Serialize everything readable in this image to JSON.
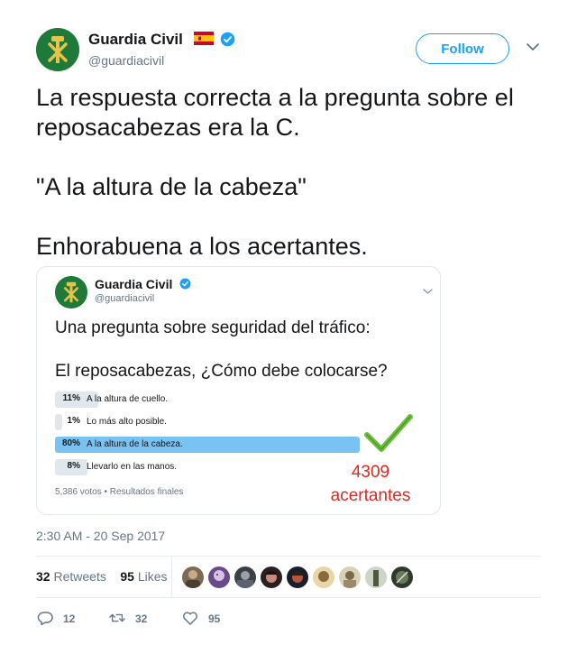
{
  "tweet": {
    "author_name": "Guardia Civil",
    "author_handle": "@guardiacivil",
    "follow_label": "Follow",
    "text": "La respuesta correcta a la pregunta sobre el\nreposacabezas era la C.\n\n\"A la altura de la cabeza\"\n\nEnhorabuena a los acertantes.",
    "timestamp": "2:30 AM - 20 Sep 2017",
    "retweets_count": "32",
    "retweets_label": "Retweets",
    "likes_count": "95",
    "likes_label": "Likes",
    "reply_count": "12",
    "retweet_action_count": "32",
    "like_action_count": "95"
  },
  "embedded": {
    "author_name": "Guardia Civil",
    "author_handle": "@guardiacivil",
    "question": "Una pregunta sobre seguridad del tráfico:\n\nEl reposacabezas, ¿Cómo debe colocarse?",
    "options": [
      {
        "percent": "11%",
        "label": "A la altura de cuello.",
        "value": 11
      },
      {
        "percent": "1%",
        "label": "Lo más alto posible.",
        "value": 1
      },
      {
        "percent": "80%",
        "label": "A la altura de la cabeza.",
        "value": 80
      },
      {
        "percent": "8%",
        "label": "Llevarlo en las manos.",
        "value": 8
      }
    ],
    "footer": "5,386 votos • Resultados finales",
    "annotation": "4309\nacertantes"
  },
  "colors": {
    "accent": "#1da1f2",
    "winner_bar": "#79c2f4",
    "loser_bar": "#e1e8ed",
    "annotation_red": "#e2261e",
    "check_green": "#6cbf3d",
    "logo_green": "#1f7a3a"
  },
  "icons": [
    "spain-flag-icon",
    "verified-badge-icon",
    "chevron-down-icon",
    "reply-icon",
    "retweet-icon",
    "heart-icon",
    "checkmark-icon",
    "guardia-civil-emblem-icon"
  ]
}
